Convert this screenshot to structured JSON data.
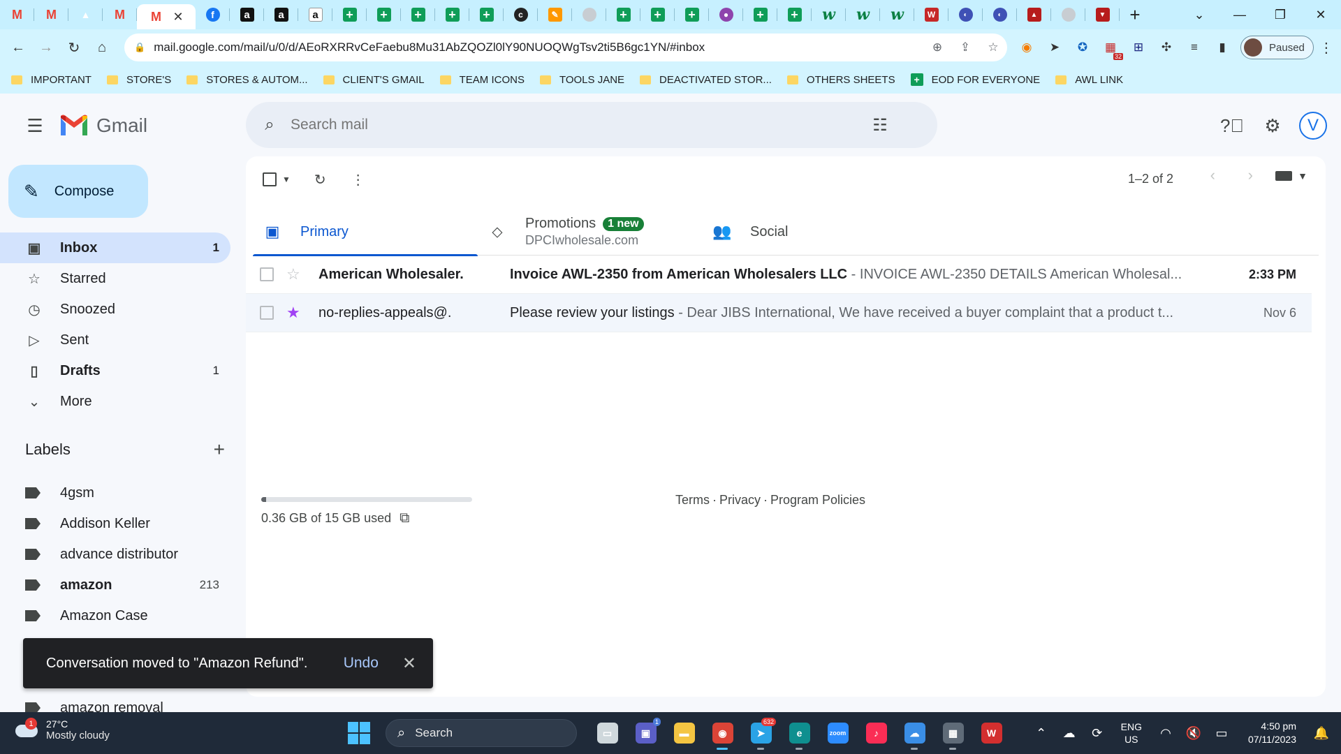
{
  "browser": {
    "tabs": [
      {
        "icon": "gmail-icon",
        "glyph": "M",
        "kind": "gmail"
      },
      {
        "icon": "gmail-icon",
        "glyph": "M",
        "kind": "gmail"
      },
      {
        "icon": "google-drive-icon",
        "glyph": "▲",
        "kind": "drive"
      },
      {
        "icon": "gmail-icon",
        "glyph": "M",
        "kind": "gmail"
      },
      {
        "icon": "active-tab",
        "glyph": "",
        "kind": "active"
      },
      {
        "icon": "facebook-icon",
        "glyph": "f",
        "kind": "fb"
      },
      {
        "icon": "amazon-icon",
        "glyph": "a",
        "kind": "amazon"
      },
      {
        "icon": "amazon-icon",
        "glyph": "a",
        "kind": "amazon"
      },
      {
        "icon": "amazon-icon",
        "glyph": "a",
        "kind": "amazon-w"
      },
      {
        "icon": "sheets-icon",
        "glyph": "+",
        "kind": "sheet"
      },
      {
        "icon": "sheets-icon",
        "glyph": "+",
        "kind": "sheet"
      },
      {
        "icon": "sheets-icon",
        "glyph": "+",
        "kind": "sheet"
      },
      {
        "icon": "sheets-icon",
        "glyph": "+",
        "kind": "sheet"
      },
      {
        "icon": "sheets-icon",
        "glyph": "+",
        "kind": "sheet"
      },
      {
        "icon": "c-logo-icon",
        "glyph": "c",
        "kind": "dark"
      },
      {
        "icon": "pencil-icon",
        "glyph": "✎",
        "kind": "pencil"
      },
      {
        "icon": "globe-icon",
        "glyph": "",
        "kind": "grey"
      },
      {
        "icon": "sheets-icon",
        "glyph": "+",
        "kind": "sheet"
      },
      {
        "icon": "sheets-icon",
        "glyph": "+",
        "kind": "sheet"
      },
      {
        "icon": "sheets-icon",
        "glyph": "+",
        "kind": "sheet"
      },
      {
        "icon": "chat-icon",
        "glyph": "●",
        "kind": "purple"
      },
      {
        "icon": "sheets-icon",
        "glyph": "+",
        "kind": "sheet"
      },
      {
        "icon": "sheets-icon",
        "glyph": "+",
        "kind": "sheet"
      },
      {
        "icon": "w-logo-icon",
        "glyph": "w",
        "kind": "w"
      },
      {
        "icon": "w-logo-icon",
        "glyph": "w",
        "kind": "w"
      },
      {
        "icon": "w-logo-icon",
        "glyph": "w",
        "kind": "w"
      },
      {
        "icon": "w-red-icon",
        "glyph": "W",
        "kind": "wred"
      },
      {
        "icon": "extension-icon",
        "glyph": "◐",
        "kind": "misc"
      },
      {
        "icon": "extension-icon",
        "glyph": "◐",
        "kind": "misc"
      },
      {
        "icon": "extension-icon",
        "glyph": "▲",
        "kind": "red"
      },
      {
        "icon": "globe-icon",
        "glyph": "",
        "kind": "grey"
      },
      {
        "icon": "extension-icon",
        "glyph": "▼",
        "kind": "red"
      }
    ],
    "url": "mail.google.com/mail/u/0/d/AEoRXRRvCeFaebu8Mu31AbZQOZl0lY90NUOQWgTsv2ti5B6gc1YN/#inbox",
    "profile_label": "Paused",
    "ext_badge": "32",
    "bookmarks": [
      {
        "label": "IMPORTANT",
        "type": "folder"
      },
      {
        "label": "STORE'S",
        "type": "folder"
      },
      {
        "label": "STORES & AUTOM...",
        "type": "folder"
      },
      {
        "label": "CLIENT'S GMAIL",
        "type": "folder"
      },
      {
        "label": "TEAM ICONS",
        "type": "folder"
      },
      {
        "label": "TOOLS JANE",
        "type": "folder"
      },
      {
        "label": "DEACTIVATED STOR...",
        "type": "folder"
      },
      {
        "label": "OTHERS SHEETS",
        "type": "folder"
      },
      {
        "label": "EOD FOR EVERYONE",
        "type": "sheet"
      },
      {
        "label": "AWL LINK",
        "type": "folder"
      }
    ]
  },
  "gmail": {
    "wordmark": "Gmail",
    "search_placeholder": "Search mail",
    "avatar_letter": "V",
    "compose_label": "Compose",
    "nav": [
      {
        "label": "Inbox",
        "count": "1",
        "icon": "inbox-icon",
        "glyph": "▣",
        "active": true,
        "bold": true
      },
      {
        "label": "Starred",
        "count": "",
        "icon": "star-icon",
        "glyph": "☆",
        "active": false,
        "bold": false
      },
      {
        "label": "Snoozed",
        "count": "",
        "icon": "clock-icon",
        "glyph": "◷",
        "active": false,
        "bold": false
      },
      {
        "label": "Sent",
        "count": "",
        "icon": "send-icon",
        "glyph": "▷",
        "active": false,
        "bold": false
      },
      {
        "label": "Drafts",
        "count": "1",
        "icon": "draft-icon",
        "glyph": "▯",
        "active": false,
        "bold": true
      },
      {
        "label": "More",
        "count": "",
        "icon": "chevron-down-icon",
        "glyph": "⌄",
        "active": false,
        "bold": false
      }
    ],
    "labels_title": "Labels",
    "labels": [
      {
        "label": "4gsm",
        "count": "",
        "bold": false
      },
      {
        "label": "Addison Keller",
        "count": "",
        "bold": false
      },
      {
        "label": "advance distributor",
        "count": "",
        "bold": false
      },
      {
        "label": "amazon",
        "count": "213",
        "bold": true
      },
      {
        "label": "Amazon Case",
        "count": "",
        "bold": false
      },
      {
        "label": "",
        "count": "",
        "bold": false
      },
      {
        "label": "",
        "count": "",
        "bold": false
      },
      {
        "label": "amazon removal",
        "count": "",
        "bold": false
      }
    ],
    "pager_text": "1–2 of 2",
    "tabs": [
      {
        "label": "Primary",
        "icon": "inbox-tab-icon",
        "glyph": "▣",
        "active": true,
        "badge": "",
        "sub": ""
      },
      {
        "label": "Promotions",
        "icon": "tag-icon",
        "glyph": "⬦",
        "active": false,
        "badge": "1 new",
        "sub": "DPCIwholesale.com"
      },
      {
        "label": "Social",
        "icon": "people-icon",
        "glyph": "👥",
        "active": false,
        "badge": "",
        "sub": ""
      }
    ],
    "emails": [
      {
        "sender": "American Wholesaler.",
        "subject": "Invoice AWL-2350 from American Wholesalers LLC",
        "snippet": " - INVOICE AWL-2350 DETAILS American Wholesal...",
        "date": "2:33 PM",
        "unread": true,
        "starred": false
      },
      {
        "sender": "no-replies-appeals@.",
        "subject": "Please review your listings",
        "snippet": " - Dear JIBS International, We have received a buyer complaint that a product t...",
        "date": "Nov 6",
        "unread": false,
        "starred": true
      }
    ],
    "storage_text": "0.36 GB of 15 GB used",
    "storage_fraction": 0.024,
    "footer": [
      "Terms",
      "Privacy",
      "Program Policies"
    ],
    "snackbar": {
      "message": "Conversation moved to \"Amazon Refund\".",
      "action": "Undo"
    }
  },
  "taskbar": {
    "weather_temp": "27°C",
    "weather_desc": "Mostly cloudy",
    "weather_badge": "1",
    "search_label": "Search",
    "apps": [
      {
        "icon": "task-view-icon",
        "color": "#cfd8dc",
        "glyph": "▭",
        "badge": "",
        "active": false
      },
      {
        "icon": "teams-icon",
        "color": "#5b5fc7",
        "glyph": "▣",
        "badge": "1",
        "active": false
      },
      {
        "icon": "file-explorer-icon",
        "color": "#f4c542",
        "glyph": "▬",
        "badge": "",
        "active": false
      },
      {
        "icon": "chrome-icon",
        "color": "#db4437",
        "glyph": "◉",
        "badge": "",
        "active": true
      },
      {
        "icon": "telegram-icon",
        "color": "#2aa3e6",
        "glyph": "➤",
        "badge": "632",
        "active": false
      },
      {
        "icon": "edge-icon",
        "color": "#0f8f8f",
        "glyph": "e",
        "badge": "",
        "active": false
      },
      {
        "icon": "zoom-icon",
        "color": "#2d8cff",
        "glyph": "zoom",
        "badge": "",
        "active": false
      },
      {
        "icon": "music-icon",
        "color": "#fa2d55",
        "glyph": "♪",
        "badge": "",
        "active": false
      },
      {
        "icon": "onedrive-icon",
        "color": "#3a8ee6",
        "glyph": "☁",
        "badge": "",
        "active": false
      },
      {
        "icon": "calculator-icon",
        "color": "#5f6b78",
        "glyph": "▦",
        "badge": "",
        "active": false
      },
      {
        "icon": "wps-icon",
        "color": "#d32f2f",
        "glyph": "W",
        "badge": "",
        "active": false
      }
    ],
    "lang_top": "ENG",
    "lang_bottom": "US",
    "time": "4:50 pm",
    "date": "07/11/2023"
  },
  "colors": {
    "accent": "#0b57d0",
    "compose": "#c2e7ff",
    "active_nav": "#d3e3fd",
    "tab_strip": "#c7f0ff"
  }
}
